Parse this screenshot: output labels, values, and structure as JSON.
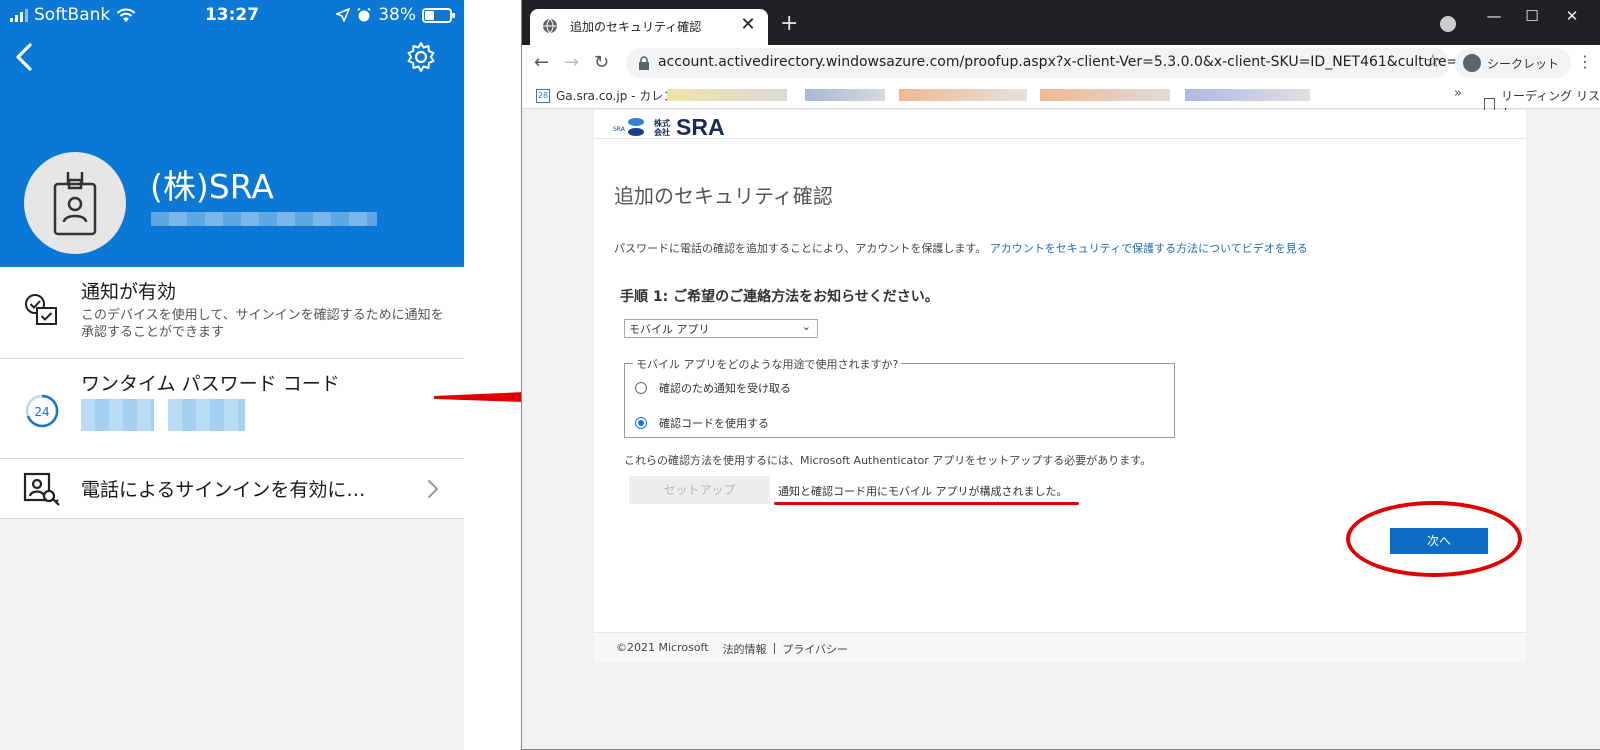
{
  "phone": {
    "status": {
      "carrier": "SoftBank",
      "time": "13:27",
      "battery": "38%",
      "battery_level": 0.38
    },
    "account": {
      "name": "(株)SRA"
    },
    "items": [
      {
        "title": "通知が有効",
        "subtitle": "このデバイスを使用して、サインインを確認するために通知を承認することができます"
      },
      {
        "title": "ワンタイム パスワード コード",
        "badge": "24"
      },
      {
        "title": "電話によるサインインを有効に…"
      }
    ]
  },
  "browser": {
    "tab": {
      "title": "追加のセキュリティ確認"
    },
    "address": {
      "url": "account.activedirectory.windowsazure.com/proofup.aspx?x-client-Ver=5.3.0.0&x-client-SKU=ID_NET461&culture=ja"
    },
    "incognito_label": "シークレット",
    "bookmarks": {
      "first": "Ga.sra.co.jp - カレン...",
      "first_icon_text": "28",
      "reading_list": "リーディング リスト"
    }
  },
  "page": {
    "logo": {
      "kaisha": "株式\n会社",
      "text": "SRA"
    },
    "title": "追加のセキュリティ確認",
    "intro": "パスワードに電話の確認を追加することにより、アカウントを保護します。",
    "intro_link": "アカウントをセキュリティで保護する方法についてビデオを見る",
    "step_heading": "手順 1: ご希望のご連絡方法をお知らせください。",
    "method_select": "モバイル アプリ",
    "usage_legend": "モバイル アプリをどのような用途で使用されますか?",
    "options": [
      {
        "label": "確認のため通知を受け取る",
        "checked": false
      },
      {
        "label": "確認コードを使用する",
        "checked": true
      }
    ],
    "requirement": "これらの確認方法を使用するには、Microsoft Authenticator アプリをセットアップする必要があります。",
    "setup_label": "セットアップ",
    "configured": "通知と確認コード用にモバイル アプリが構成されました。",
    "next_label": "次へ",
    "footer": {
      "copyright": "©2021 Microsoft",
      "legal": "法的情報",
      "sep": "|",
      "privacy": "プライバシー"
    }
  },
  "colors": {
    "phone_header": "#0a78d4",
    "annotation_red": "#e00000",
    "primary_button": "#0b6ec4",
    "link": "#1f6fb5"
  }
}
